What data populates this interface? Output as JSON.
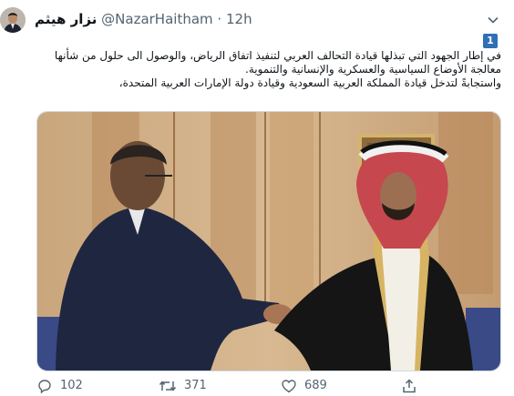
{
  "tweet": {
    "author_name": "نزار هيثم",
    "author_handle": "@NazarHaitham",
    "separator": "·",
    "time": "12h",
    "number_badge": "1",
    "lines": [
      "في إطار الجهود التي تبذلها قيادة التحالف العربي لتنفيذ اتفاق الرياض، والوصول الى حلول من شأنها",
      "معالجة الأوضاع السياسية والعسكرية والإنسانية والتنموية.",
      "واستجابةً لتدخل قيادة المملكة العربية السعودية وقيادة دولة الإمارات العربية المتحدة،"
    ],
    "actions": {
      "replies": "102",
      "retweets": "371",
      "likes": "689"
    }
  },
  "icons": {
    "caret": "chevron-down-icon",
    "reply": "reply-icon",
    "retweet": "retweet-icon",
    "like": "heart-icon",
    "share": "share-icon"
  },
  "colors": {
    "text": "#0f1419",
    "secondary": "#536471",
    "badge": "#2f6fb5"
  }
}
